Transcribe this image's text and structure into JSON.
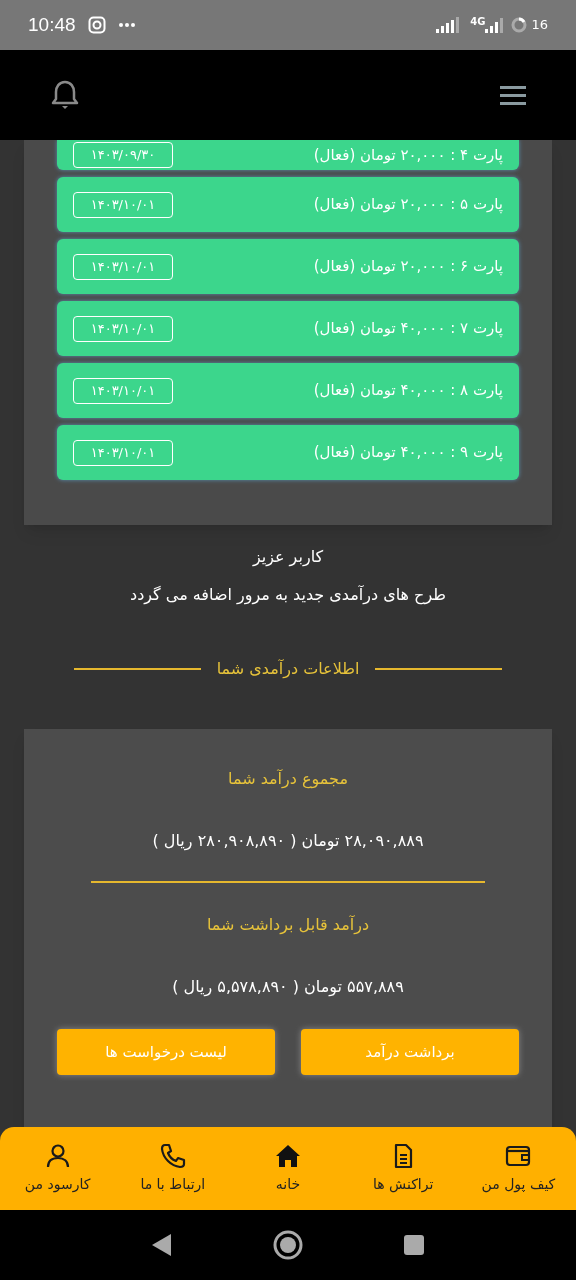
{
  "status_bar": {
    "time": "10:48",
    "network": "4G",
    "battery": "16"
  },
  "plans": [
    {
      "label": "پارت ۴ : ۲۰,۰۰۰ تومان (فعال)",
      "date": "۱۴۰۳/۰۹/۳۰",
      "partial": true
    },
    {
      "label": "پارت ۵ : ۲۰,۰۰۰ تومان (فعال)",
      "date": "۱۴۰۳/۱۰/۰۱",
      "partial": false
    },
    {
      "label": "پارت ۶ : ۲۰,۰۰۰ تومان (فعال)",
      "date": "۱۴۰۳/۱۰/۰۱",
      "partial": false
    },
    {
      "label": "پارت ۷ : ۴۰,۰۰۰ تومان (فعال)",
      "date": "۱۴۰۳/۱۰/۰۱",
      "partial": false
    },
    {
      "label": "پارت ۸ : ۴۰,۰۰۰ تومان (فعال)",
      "date": "۱۴۰۳/۱۰/۰۱",
      "partial": false
    },
    {
      "label": "پارت ۹ : ۴۰,۰۰۰ تومان (فعال)",
      "date": "۱۴۰۳/۱۰/۰۱",
      "partial": false
    }
  ],
  "notice": {
    "greeting": "کاربر عزیز",
    "message": "طرح های درآمدی جدید به مرور اضافه می گردد"
  },
  "section_title": "اطلاعات درآمدی شما",
  "income": {
    "total_title": "مجموع درآمد شما",
    "total_value": "۲۸,۰۹۰,۸۸۹ تومان ( ۲۸۰,۹۰۸,۸۹۰ ریال )",
    "withdrawable_title": "درآمد قابل برداشت شما",
    "withdrawable_value": "۵۵۷,۸۸۹ تومان ( ۵,۵۷۸,۸۹۰ ریال )",
    "buttons": [
      "برداشت درآمد",
      "لیست درخواست ها"
    ]
  },
  "bottom_nav": [
    {
      "kind": "wallet",
      "label": "کیف پول من"
    },
    {
      "kind": "document",
      "label": "تراکنش ها"
    },
    {
      "kind": "home",
      "label": "خانه"
    },
    {
      "kind": "phone",
      "label": "ارتباط با ما"
    },
    {
      "kind": "user",
      "label": "کارسود من"
    }
  ]
}
